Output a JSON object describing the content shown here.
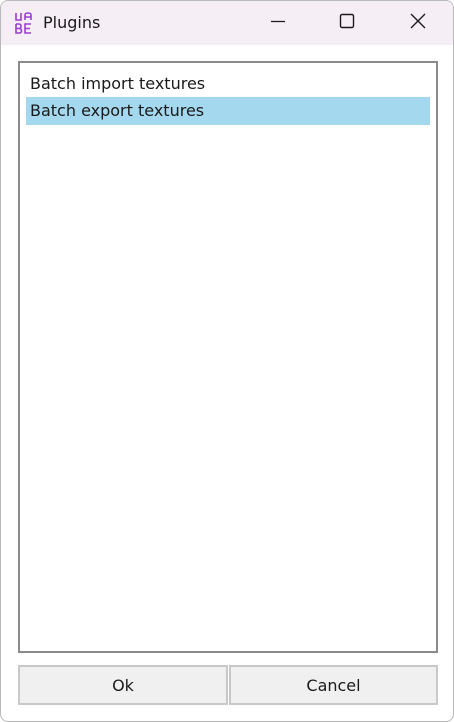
{
  "window": {
    "title": "Plugins",
    "app_icon": "uabe-icon",
    "controls": [
      "minimize-icon",
      "maximize-icon",
      "close-icon"
    ]
  },
  "plugins": {
    "items": [
      {
        "label": "Batch import textures",
        "selected": false
      },
      {
        "label": "Batch export textures",
        "selected": true
      }
    ]
  },
  "buttons": {
    "ok_label": "Ok",
    "cancel_label": "Cancel"
  },
  "colors": {
    "titlebar_bg": "#f6eef5",
    "selection_bg": "#a4d8ef",
    "icon_purple": "#9b3fd1"
  }
}
